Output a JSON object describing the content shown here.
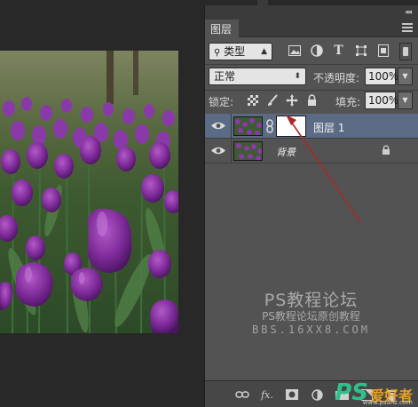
{
  "panel": {
    "tab_label": "图层",
    "collapse_glyph": "◂◂",
    "filter": {
      "selected": "类型"
    },
    "blend_mode": "正常",
    "opacity_label": "不透明度:",
    "opacity_value": "100%",
    "lock_label": "锁定:",
    "fill_label": "填充:",
    "fill_value": "100%"
  },
  "layers": [
    {
      "name": "图层 1",
      "visible": true,
      "selected": true,
      "has_mask": true
    },
    {
      "name": "背景",
      "visible": true,
      "selected": false,
      "locked": true
    }
  ],
  "bottom_bar": {
    "icons": [
      "link-icon",
      "fx-icon",
      "mask-icon",
      "adjustment-icon",
      "group-icon",
      "new-layer-icon",
      "trash-icon"
    ],
    "fx_label": "fx."
  },
  "watermark": {
    "line1": "PS教程论坛",
    "line2": "PS教程论坛原创教程",
    "line3": "BBS.16XX8.COM"
  },
  "corner_logo": {
    "ps": "PS",
    "cn": "爱好者",
    "url": "www.psahz.com"
  },
  "colors": {
    "panel_bg": "#535353",
    "selected_layer": "#5b6b85",
    "arrow": "#a82a2a"
  }
}
